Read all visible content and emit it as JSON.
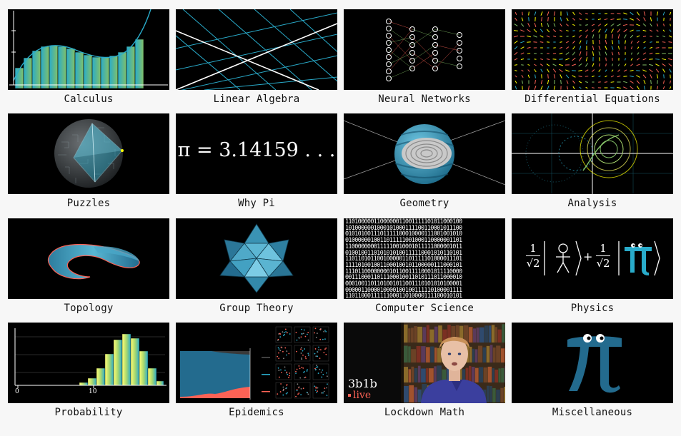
{
  "topics": [
    {
      "label": "Calculus"
    },
    {
      "label": "Linear Algebra"
    },
    {
      "label": "Neural Networks"
    },
    {
      "label": "Differential Equations"
    },
    {
      "label": "Puzzles"
    },
    {
      "label": "Why Pi"
    },
    {
      "label": "Geometry"
    },
    {
      "label": "Analysis"
    },
    {
      "label": "Topology"
    },
    {
      "label": "Group Theory"
    },
    {
      "label": "Computer Science"
    },
    {
      "label": "Physics"
    },
    {
      "label": "Probability"
    },
    {
      "label": "Epidemics"
    },
    {
      "label": "Lockdown Math"
    },
    {
      "label": "Miscellaneous"
    }
  ],
  "thumb_text": {
    "why_pi": "π = 3.14159 . . .",
    "physics_frac": "1",
    "physics_sqrt": "√2",
    "physics_plus": "+",
    "prob_tick_0": "0",
    "prob_tick_10": "10",
    "lockdown_brand": "3b1b",
    "lockdown_live": "live",
    "binary_lines": [
      "1101000001100000011001111101011000100",
      "1010000001000101000111100110001011100",
      "0101010011101111100010000111001001010",
      "0100000010011011111001000110000001101",
      "1100000000111110010001011111000001011",
      "0100100110101010100111110001010110101",
      "1101101011001000001101111101000011101",
      "1111010010011000100101100000111000101",
      "1110110000000010110011110001011110000",
      "0011100011011100010011010111011000010",
      "0001001101101001011001110101010100001",
      "0000011000010000100100111110100001111",
      "1101100011111100011010000111100010101"
    ]
  },
  "colors": {
    "background": "#f7f7f7",
    "thumb_bg": "#000000",
    "blue": "#29abca",
    "teal": "#236b8e",
    "yellow": "#ffff00",
    "green": "#83c167",
    "red": "#fc6255",
    "label": "#111111"
  }
}
